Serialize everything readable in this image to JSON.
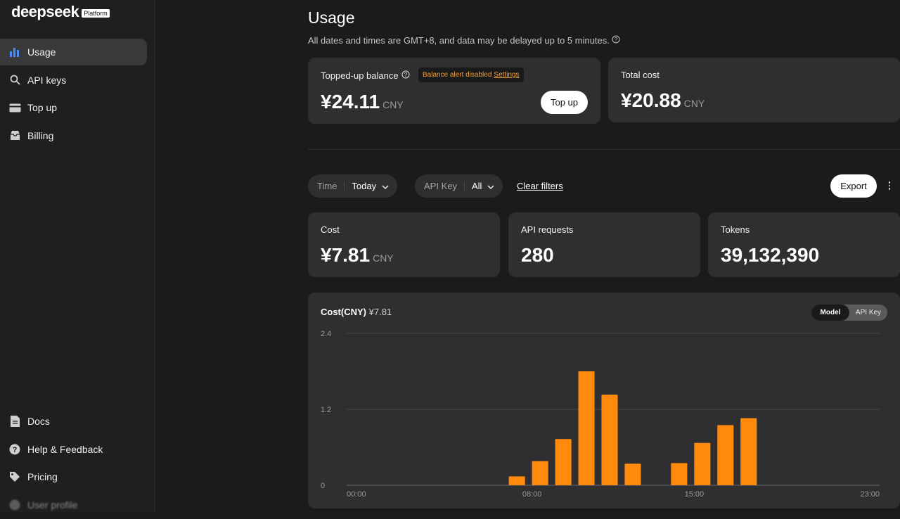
{
  "sidebar": {
    "logo": {
      "word": "deepseek",
      "badge": "Platform"
    },
    "items": [
      {
        "label": "Usage",
        "icon": "bar-chart-icon",
        "active": true
      },
      {
        "label": "API keys",
        "icon": "search-icon",
        "active": false
      },
      {
        "label": "Top up",
        "icon": "credit-card-icon",
        "active": false
      },
      {
        "label": "Billing",
        "icon": "inbox-icon",
        "active": false
      }
    ],
    "bottom_items": [
      {
        "label": "Docs",
        "icon": "document-icon"
      },
      {
        "label": "Help & Feedback",
        "icon": "help-icon"
      },
      {
        "label": "Pricing",
        "icon": "tag-icon"
      },
      {
        "label": "User profile",
        "icon": "avatar-icon"
      }
    ]
  },
  "header": {
    "title": "Usage",
    "subtitle": "All dates and times are GMT+8, and data may be delayed up to 5 minutes."
  },
  "balance": {
    "label": "Topped-up balance",
    "alert_text": "Balance alert disabled",
    "alert_link": "Settings",
    "value": "¥24.11",
    "unit": "CNY",
    "topup_label": "Top up"
  },
  "total_cost": {
    "label": "Total cost",
    "value": "¥20.88",
    "unit": "CNY"
  },
  "filters": {
    "time_label": "Time",
    "time_value": "Today",
    "apikey_label": "API Key",
    "apikey_value": "All",
    "clear_label": "Clear filters",
    "export_label": "Export"
  },
  "stats": {
    "cost": {
      "label": "Cost",
      "value": "¥7.81",
      "unit": "CNY"
    },
    "requests": {
      "label": "API requests",
      "value": "280"
    },
    "tokens": {
      "label": "Tokens",
      "value": "39,132,390"
    }
  },
  "chart_panel": {
    "title": "Cost(CNY)",
    "total": "¥7.81",
    "toggle": {
      "model": "Model",
      "api_key": "API Key",
      "selected": "Model"
    }
  },
  "chart_data": {
    "type": "bar",
    "title": "Cost(CNY) ¥7.81",
    "color": "#ff8a0d",
    "x_range": [
      0,
      23
    ],
    "x_ticks": [
      "00:00",
      "08:00",
      "15:00",
      "23:00"
    ],
    "x_tick_hours": [
      0,
      8,
      15,
      23
    ],
    "y_ticks": [
      "0",
      "1.2",
      "2.4"
    ],
    "ylim": [
      0,
      2.4
    ],
    "grid": true,
    "hours": [
      7,
      8,
      9,
      10,
      11,
      12,
      14,
      15,
      16,
      17
    ],
    "values": [
      0.14,
      0.38,
      0.73,
      1.8,
      1.43,
      0.34,
      0.35,
      0.67,
      0.95,
      1.06
    ]
  }
}
